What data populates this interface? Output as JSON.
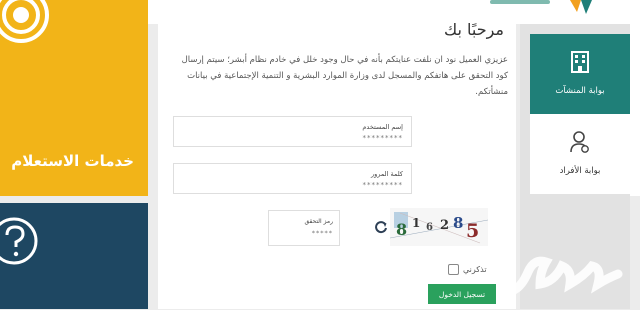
{
  "left_tiles": {
    "inquiry_services": "خدمات الاستعلام"
  },
  "main": {
    "welcome_title": "مرحبًا بك",
    "welcome_message": "عزيزي العميل نود ان نلفت عنايتكم بأنه في حال وجود خلل في خادم نظام أبشر؛ سيتم إرسال كود التحقق على هاتفكم والمسجل لدى وزارة الموارد البشرية و التنمية الإجتماعية في بيانات منشأتكم.",
    "username": {
      "label": "إسم المستخدم",
      "value": "*********"
    },
    "password": {
      "label": "كلمة المرور",
      "value": "*********"
    },
    "captcha": {
      "label": "رمز التحقق",
      "value": "*****",
      "image_text": "816285"
    },
    "remember_label": "تذكرني",
    "login_label": "تسجيل الدخول"
  },
  "nav": {
    "establishments_portal": "بوابة المنشآت",
    "individuals_portal": "بوابة الأفراد"
  },
  "colors": {
    "yellow_tile": "#f2b418",
    "blue_tile": "#1e4762",
    "nav_active": "#1f7f78",
    "login_button": "#2aa15d"
  },
  "icons": {
    "inquiry": "broadcast-icon",
    "help": "question-icon",
    "establishments": "building-icon",
    "individuals": "user-gear-icon",
    "refresh": "refresh-icon"
  }
}
